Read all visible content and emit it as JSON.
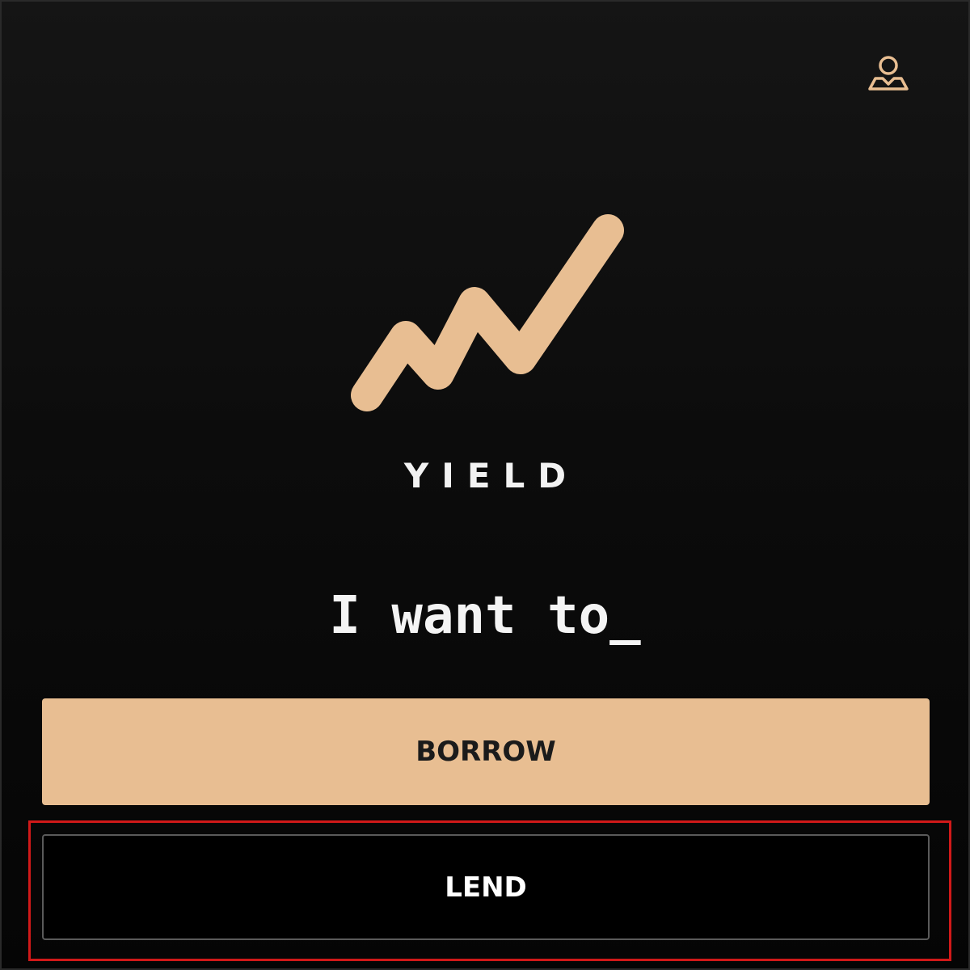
{
  "header": {
    "profile_icon": "user-profile-icon"
  },
  "brand": {
    "logo_icon": "trending-line-icon",
    "name": "YIELD",
    "accent_color": "#e8be92"
  },
  "main": {
    "prompt": "I want to_",
    "actions": {
      "borrow_label": "BORROW",
      "lend_label": "LEND"
    }
  }
}
